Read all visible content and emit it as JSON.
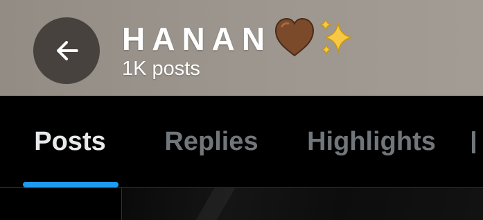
{
  "header": {
    "back_icon": "arrow-left-icon",
    "profile_name": "HANAN",
    "name_emojis": [
      "brown-heart-icon",
      "sparkles-icon"
    ],
    "post_count": "1K posts",
    "colors": {
      "background": "#9c968e",
      "back_button": "#47423d"
    }
  },
  "tabs": {
    "items": [
      {
        "label": "Posts",
        "active": true
      },
      {
        "label": "Replies",
        "active": false
      },
      {
        "label": "Highlights",
        "active": false
      }
    ],
    "colors": {
      "active": "#e7e9ea",
      "inactive": "#71767b",
      "indicator": "#1d9bf0"
    }
  }
}
